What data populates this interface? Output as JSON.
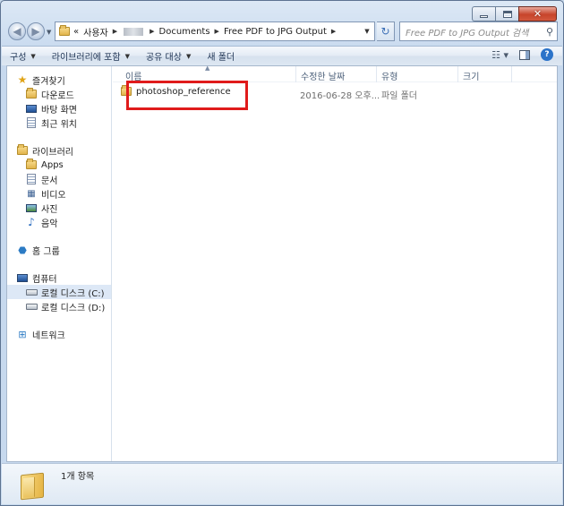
{
  "address_bar": {
    "overflow": "«",
    "segments": [
      "사용자",
      "Documents",
      "Free PDF to JPG Output"
    ]
  },
  "search": {
    "placeholder": "Free PDF to JPG Output 검색"
  },
  "toolbar": {
    "organize": "구성",
    "include_in_library": "라이브러리에 포함",
    "share_with": "공유 대상",
    "new_folder": "새 폴더"
  },
  "sidebar": {
    "favorites": {
      "label": "즐겨찾기",
      "items": [
        "다운로드",
        "바탕 화면",
        "최근 위치"
      ]
    },
    "libraries": {
      "label": "라이브러리",
      "items": [
        "Apps",
        "문서",
        "비디오",
        "사진",
        "음악"
      ]
    },
    "homegroup": {
      "label": "홈 그룹"
    },
    "computer": {
      "label": "컴퓨터",
      "items": [
        "로컬 디스크 (C:)",
        "로컬 디스크 (D:)"
      ]
    },
    "network": {
      "label": "네트워크"
    }
  },
  "columns": {
    "name": "이름",
    "date": "수정한 날짜",
    "type": "유형",
    "size": "크기"
  },
  "files": [
    {
      "name": "photoshop_reference",
      "date": "2016-06-28 오후...",
      "type": "파일 폴더"
    }
  ],
  "status": {
    "count": "1개 항목"
  },
  "colors": {
    "highlight": "#e01b1b",
    "accent": "#2b73c9"
  }
}
